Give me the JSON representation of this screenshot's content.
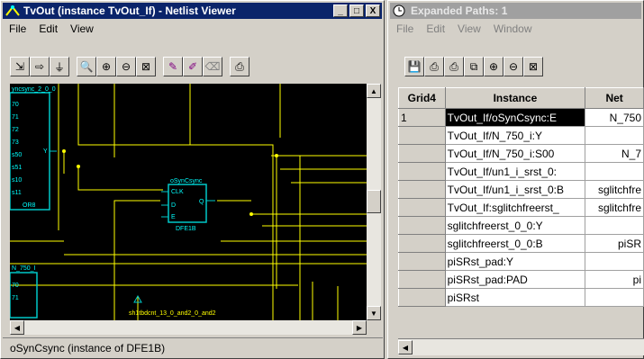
{
  "left_window": {
    "title": "TvOut (instance TvOut_If) - Netlist Viewer",
    "controls": {
      "minimize": "_",
      "maximize": "□",
      "close": "X"
    },
    "menu": [
      "File",
      "Edit",
      "View"
    ],
    "toolbar_icons": [
      "push-hierarchy-icon",
      "forward-icon",
      "probe-icon",
      "zoom-area-icon",
      "zoom-in-icon",
      "zoom-out-icon",
      "zoom-fit-icon",
      "highlight-icon",
      "unhighlight-icon",
      "erase-icon",
      "print-icon"
    ],
    "schematic": {
      "block_left_label": "yncsync_2_0_0",
      "block_left_name": "OR8",
      "block_left_pins": [
        "70",
        "71",
        "72",
        "73",
        "s50",
        "s51",
        "s10",
        "s11"
      ],
      "block_left_out": "Y",
      "cell_instance": "oSynCsync",
      "cell_type": "DFE1B",
      "cell_pins": [
        "CLK",
        "D",
        "E",
        "Q"
      ],
      "block_bottom_label": "N_750_I",
      "block_bottom_pins": [
        "70",
        "71"
      ],
      "bottom_wire_label": "sh1tbdcnt_13_0_and2_0_and2"
    },
    "status": "oSynCsync (instance of DFE1B)"
  },
  "right_window": {
    "title": "Expanded Paths: 1",
    "menu": [
      "File",
      "Edit",
      "View",
      "Window"
    ],
    "toolbar_icons": [
      "save-icon",
      "print-icon",
      "print-preview-icon",
      "copy-icon",
      "zoom-in-icon",
      "zoom-out-icon",
      "zoom-fit-icon"
    ],
    "table": {
      "headers": [
        "Grid4",
        "Instance",
        "Net"
      ],
      "rows": [
        [
          "1",
          "TvOut_If/oSynCsync:E",
          "N_750"
        ],
        [
          "",
          "TvOut_If/N_750_i:Y",
          ""
        ],
        [
          "",
          "TvOut_If/N_750_i:S00",
          "N_7"
        ],
        [
          "",
          "TvOut_If/un1_i_srst_0:",
          ""
        ],
        [
          "",
          "TvOut_If/un1_i_srst_0:B",
          "sglitchfre"
        ],
        [
          "",
          "TvOut_If:sglitchfreerst_",
          "sglitchfre"
        ],
        [
          "",
          "sglitchfreerst_0_0:Y",
          ""
        ],
        [
          "",
          "sglitchfreerst_0_0:B",
          "piSR"
        ],
        [
          "",
          "piSRst_pad:Y",
          ""
        ],
        [
          "",
          "piSRst_pad:PAD",
          "pi"
        ],
        [
          "",
          "piSRst",
          ""
        ]
      ]
    }
  },
  "colors": {
    "title_active": "#0a246a",
    "title_inactive": "#a0a0a0",
    "wire": "#ffff00",
    "component": "#00c8c8",
    "canvas": "#000000"
  }
}
